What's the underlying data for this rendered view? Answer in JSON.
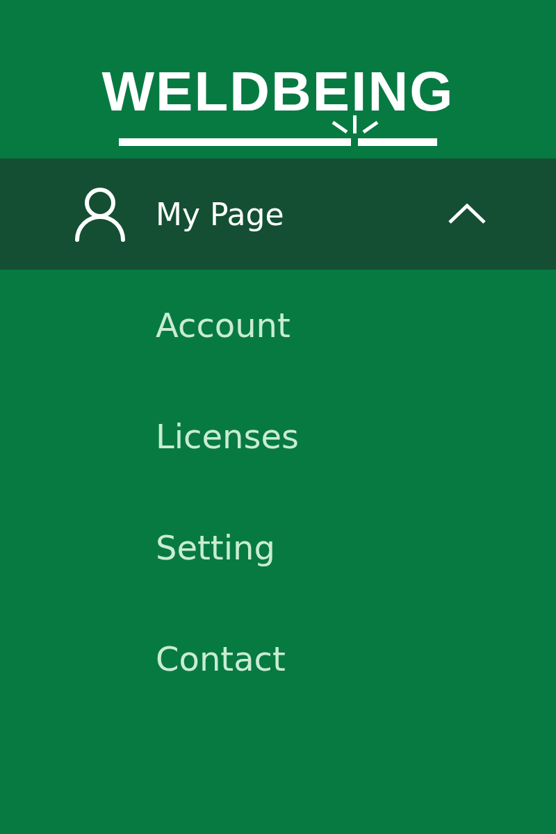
{
  "logo": {
    "text": "WELDBEING"
  },
  "menu": {
    "label": "My Page",
    "expanded": true,
    "items": [
      {
        "label": "Account"
      },
      {
        "label": "Licenses"
      },
      {
        "label": "Setting"
      },
      {
        "label": "Contact"
      }
    ]
  }
}
